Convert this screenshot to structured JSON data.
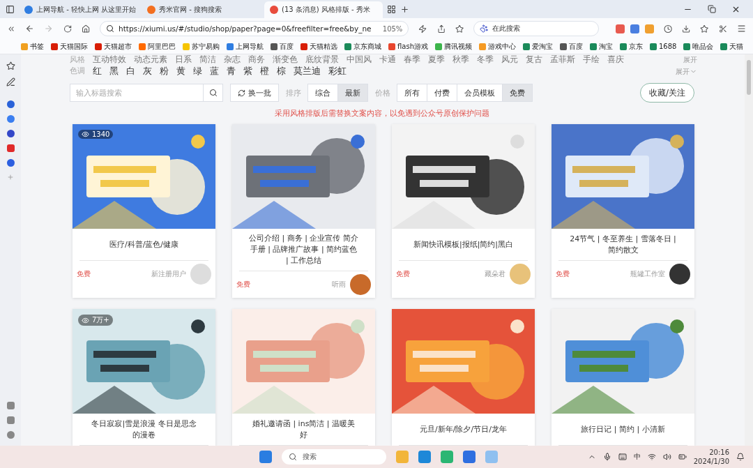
{
  "tabs": [
    {
      "label": "上网导航 - 轻快上网 从这里开始",
      "kind": "ie",
      "selected": false
    },
    {
      "label": "秀米官网 - 搜狗搜索",
      "kind": "sogou",
      "selected": false
    },
    {
      "label": "(13 条消息) 风格排版 - 秀米",
      "kind": "xiumi",
      "selected": true
    }
  ],
  "address_bar": {
    "url": "https://xiumi.us/#/studio/shop/paper?page=0&freefilter=free&by_ne",
    "zoom": "105%",
    "search_placeholder": "在此搜索"
  },
  "bookmarks": [
    {
      "label": "书签",
      "color": "#f0a020"
    },
    {
      "label": "天猫国际",
      "color": "#d81e06"
    },
    {
      "label": "天猫超市",
      "color": "#d81e06"
    },
    {
      "label": "阿里巴巴",
      "color": "#ff6a00"
    },
    {
      "label": "苏宁易购",
      "color": "#f5c400"
    },
    {
      "label": "上网导航",
      "color": "#2f7de1"
    },
    {
      "label": "百度",
      "color": "#555555"
    },
    {
      "label": "天猫精选",
      "color": "#d81e06"
    },
    {
      "label": "京东商城",
      "color": "#1a8a5a"
    },
    {
      "label": "flash游戏",
      "color": "#e8462e"
    },
    {
      "label": "腾讯视频",
      "color": "#3cb44b"
    },
    {
      "label": "游戏中心",
      "color": "#f59a23"
    },
    {
      "label": "爱淘宝",
      "color": "#1a8a5a"
    },
    {
      "label": "百度",
      "color": "#555555"
    },
    {
      "label": "淘宝",
      "color": "#1a8a5a"
    },
    {
      "label": "京东",
      "color": "#1a8a5a"
    },
    {
      "label": "1688",
      "color": "#1a8a5a"
    },
    {
      "label": "唯品会",
      "color": "#1a8a5a"
    },
    {
      "label": "天猫",
      "color": "#1a8a5a"
    }
  ],
  "style_filter": {
    "label": "风格",
    "items": [
      "互动特效",
      "动态元素",
      "日系",
      "简洁",
      "杂志",
      "商务",
      "渐变色",
      "底纹背景",
      "中国风",
      "卡通",
      "春季",
      "夏季",
      "秋季",
      "冬季",
      "风元",
      "复古",
      "孟菲斯",
      "手绘",
      "喜庆"
    ],
    "expand": "展开"
  },
  "color_filter": {
    "label": "色调",
    "items": [
      "红",
      "黑",
      "白",
      "灰",
      "粉",
      "黄",
      "绿",
      "蓝",
      "青",
      "紫",
      "橙",
      "棕",
      "莫兰迪",
      "彩虹"
    ],
    "expand": "展开"
  },
  "toolbar": {
    "search_placeholder": "输入标题搜索",
    "refresh": "换一批",
    "sort_label": "排序",
    "sort_options": [
      {
        "label": "综合",
        "selected": false
      },
      {
        "label": "最新",
        "selected": true
      }
    ],
    "price_label": "价格",
    "price_options": [
      {
        "label": "所有",
        "selected": false
      },
      {
        "label": "付费",
        "selected": false
      },
      {
        "label": "会员模板",
        "selected": false
      },
      {
        "label": "免费",
        "selected": true
      }
    ],
    "follow": "收藏/关注"
  },
  "notice": "采用风格排版后需替换文案内容，以免遇到公众号原创保护问题",
  "cards": [
    {
      "kind": "picture",
      "views": "1340",
      "caption": "医疗/科普/蓝色/健康",
      "price": "免费",
      "author": "新注册用户"
    },
    {
      "kind": "picture",
      "caption": "公司介绍 | 商务 | 企业宣传 简介手册 | 品牌推广故事 | 简约蓝色 | 工作总结",
      "price": "免费",
      "author": "听雨"
    },
    {
      "kind": "picture",
      "caption": "新闻快讯模板|报纸|简约|黑白",
      "price": "免费",
      "author": "藏朵君"
    },
    {
      "kind": "picture",
      "caption": "24节气 | 冬至养生 | 雪落冬日 | 简约散文",
      "price": "免费",
      "author": "瓶罐工作室"
    },
    {
      "kind": "picture",
      "views": "7万+",
      "caption": "冬日寂寂|雪是浪漫 冬日是思念的漫卷"
    },
    {
      "kind": "picture",
      "caption": "婚礼邀请函 | ins简洁 | 温暖美好"
    },
    {
      "kind": "picture",
      "caption": "元旦/新年/除夕/节日/龙年"
    },
    {
      "kind": "picture",
      "caption": "旅行日记 | 简约 | 小清新"
    }
  ],
  "taskbar": {
    "search": "搜索",
    "ime": "中",
    "time": "20:16",
    "date": "2024/1/30"
  }
}
